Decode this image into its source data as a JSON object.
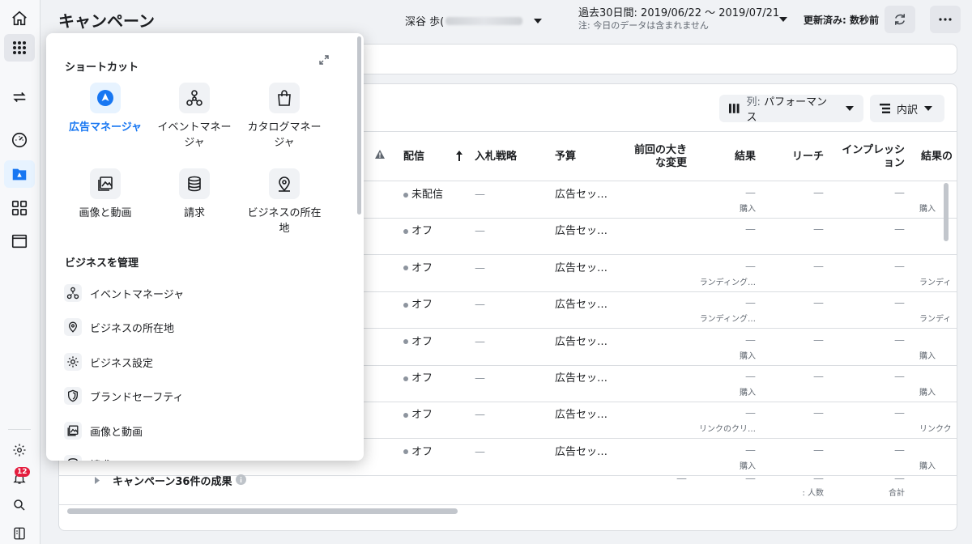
{
  "header": {
    "title": "キャンペーン",
    "account_name": "深谷 歩(",
    "date_range": "過去30日間: 2019/06/22 〜 2019/07/21",
    "date_note": "注: 今日のデータは含まれません",
    "updated": "更新済み: 数秒前"
  },
  "sidebar": {
    "notification_count": "12",
    "icons": [
      "home-icon",
      "apps-grid-icon",
      "switch-icon",
      "dashboard-icon",
      "ads-manager-icon",
      "catalog-icon",
      "window-icon",
      "settings-icon",
      "bell-icon",
      "search-icon",
      "panel-icon"
    ]
  },
  "toolbar": {
    "columns_prefix": "列:",
    "columns_value": "パフォーマンス",
    "breakdown": "内訳"
  },
  "table": {
    "headers": {
      "delivery": "配信",
      "bid_strategy": "入札戦略",
      "budget": "予算",
      "last_change": "前回の大き\nな変更",
      "results": "結果",
      "reach": "リーチ",
      "impressions": "インプレッシ\nョン",
      "results_cut": "結果の"
    },
    "rows": [
      {
        "status": "未配信",
        "bid": "—",
        "budget": "広告セッ…",
        "result": "—",
        "result_sub": "購入",
        "reach": "—",
        "imp": "—",
        "cut": "購入"
      },
      {
        "status": "オフ",
        "bid": "—",
        "budget": "広告セッ…",
        "result": "—",
        "result_sub": "",
        "reach": "—",
        "imp": "—",
        "cut": ""
      },
      {
        "status": "オフ",
        "bid": "—",
        "budget": "広告セッ…",
        "result": "—",
        "result_sub": "ランディング…",
        "reach": "—",
        "imp": "—",
        "cut": "ランディ"
      },
      {
        "status": "オフ",
        "bid": "—",
        "budget": "広告セッ…",
        "result": "—",
        "result_sub": "ランディング…",
        "reach": "—",
        "imp": "—",
        "cut": "ランディ"
      },
      {
        "status": "オフ",
        "bid": "—",
        "budget": "広告セッ…",
        "result": "—",
        "result_sub": "購入",
        "reach": "—",
        "imp": "—",
        "cut": "購入"
      },
      {
        "status": "オフ",
        "bid": "—",
        "budget": "広告セッ…",
        "result": "—",
        "result_sub": "購入",
        "reach": "—",
        "imp": "—",
        "cut": "購入"
      },
      {
        "status": "オフ",
        "bid": "—",
        "budget": "広告セッ…",
        "result": "—",
        "result_sub": "リンクのクリ…",
        "reach": "—",
        "imp": "—",
        "cut": "リンクク"
      },
      {
        "status": "オフ",
        "bid": "—",
        "budget": "広告セッ…",
        "result": "—",
        "result_sub": "購入",
        "reach": "—",
        "imp": "—",
        "cut": "購入"
      }
    ],
    "summary": {
      "label": "キャンペーン36件の成果",
      "last_change": "—",
      "result": "—",
      "reach": "—",
      "reach_sub": ": 人数",
      "imp": "—",
      "imp_sub": "合計"
    }
  },
  "popup": {
    "shortcuts_title": "ショートカット",
    "shortcuts": [
      {
        "label": "広告マネージャ",
        "icon": "ads-manager-icon"
      },
      {
        "label": "イベントマネー\nジャ",
        "icon": "events-manager-icon"
      },
      {
        "label": "カタログマネー\nジャ",
        "icon": "catalog-icon"
      },
      {
        "label": "画像と動画",
        "icon": "media-icon"
      },
      {
        "label": "請求",
        "icon": "billing-icon"
      },
      {
        "label": "ビジネスの所在\n地",
        "icon": "location-icon"
      }
    ],
    "manage_title": "ビジネスを管理",
    "manage_items": [
      {
        "label": "イベントマネージャ",
        "icon": "events-manager-icon"
      },
      {
        "label": "ビジネスの所在地",
        "icon": "location-icon"
      },
      {
        "label": "ビジネス設定",
        "icon": "gear-icon"
      },
      {
        "label": "ブランドセーフティ",
        "icon": "shield-icon"
      },
      {
        "label": "画像と動画",
        "icon": "media-icon"
      },
      {
        "label": "請求",
        "icon": "billing-icon"
      }
    ]
  }
}
